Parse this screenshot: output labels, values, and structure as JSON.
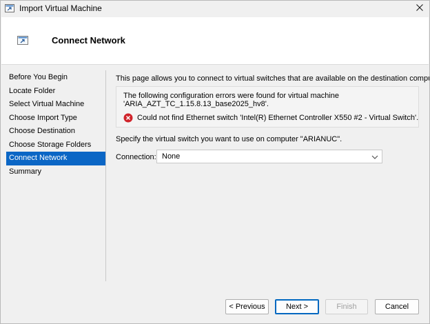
{
  "window": {
    "title": "Import Virtual Machine"
  },
  "header": {
    "title": "Connect Network"
  },
  "nav": {
    "items": [
      {
        "label": "Before You Begin"
      },
      {
        "label": "Locate Folder"
      },
      {
        "label": "Select Virtual Machine"
      },
      {
        "label": "Choose Import Type"
      },
      {
        "label": "Choose Destination"
      },
      {
        "label": "Choose Storage Folders"
      },
      {
        "label": "Connect Network"
      },
      {
        "label": "Summary"
      }
    ],
    "active": "Connect Network"
  },
  "content": {
    "intro": "This page allows you to connect to virtual switches that are available on the destination computer.",
    "error_box": {
      "line1": "The following configuration errors were found for virtual machine",
      "line2": "'ARIA_AZT_TC_1.15.8.13_base2025_hv8'.",
      "message": "Could not find Ethernet switch 'Intel(R) Ethernet Controller X550 #2 - Virtual Switch'."
    },
    "specify": "Specify the virtual switch you want to use on computer \"ARIANUC\".",
    "connection_label": "Connection:",
    "connection_value": "None"
  },
  "buttons": {
    "previous": "< Previous",
    "next": "Next >",
    "finish": "Finish",
    "cancel": "Cancel"
  },
  "colors": {
    "accent": "#0b66c5",
    "error": "#d0242b"
  },
  "icons": {
    "title": "vm-import-icon",
    "header": "vm-import-icon",
    "close": "close-icon",
    "error": "error-icon",
    "dropdown": "chevron-down-icon"
  }
}
